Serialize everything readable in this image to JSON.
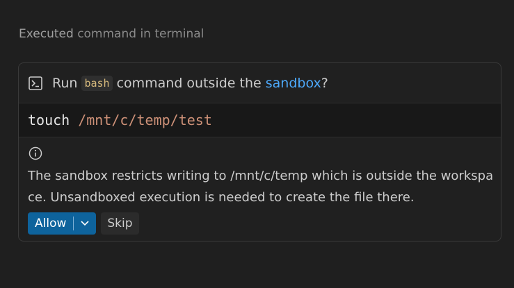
{
  "status": {
    "verb": "Executed",
    "rest": "command in terminal"
  },
  "prompt": {
    "run": "Run",
    "shell": "bash",
    "middle": "command outside the",
    "link": "sandbox",
    "end": "?"
  },
  "command": {
    "name": "touch",
    "arg": "/mnt/c/temp/test"
  },
  "message": "The sandbox restricts writing to /mnt/c/temp which is outside the workspace. Unsandboxed execution is needed to create the file there.",
  "actions": {
    "allow_label": "Allow",
    "skip_label": "Skip"
  },
  "icons": {
    "header": "terminal-icon",
    "info": "info-icon",
    "dropdown": "chevron-down-icon"
  },
  "colors": {
    "accent_button": "#0e639c",
    "link": "#4daafc",
    "shell_chip_text": "#d7ba7d",
    "path_text": "#ce9178"
  }
}
